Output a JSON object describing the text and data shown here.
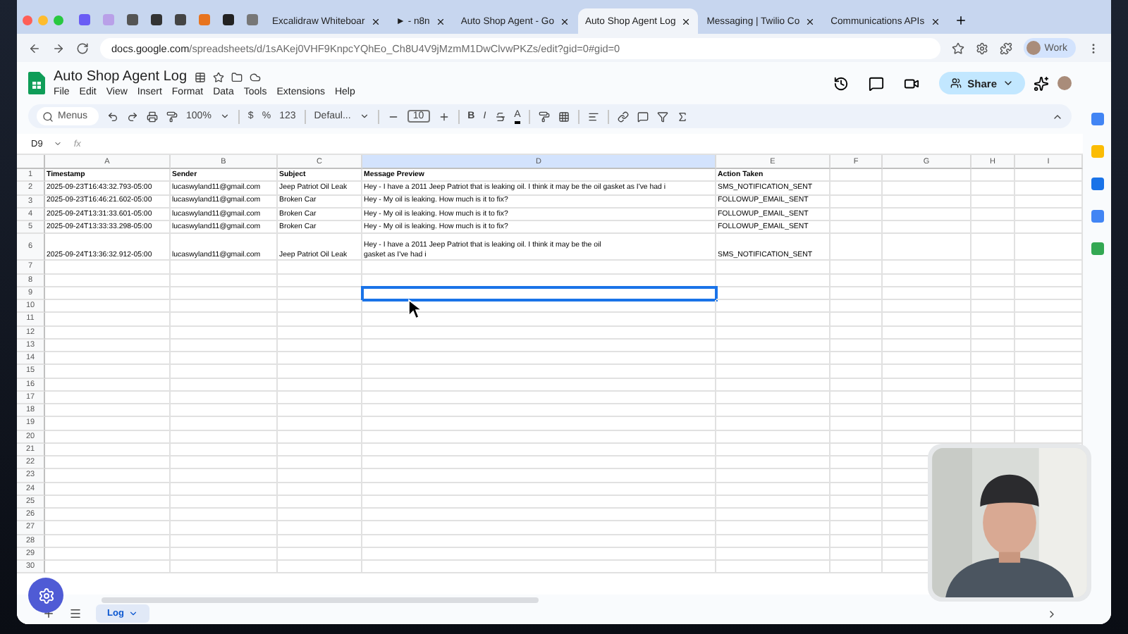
{
  "browser": {
    "tabs": [
      {
        "label": "Excalidraw Whiteboar",
        "selected": false
      },
      {
        "label": "► - n8n",
        "selected": false
      },
      {
        "label": "Auto Shop Agent - Go",
        "selected": false
      },
      {
        "label": "Auto Shop Agent Log",
        "selected": true
      },
      {
        "label": "Messaging | Twilio Co",
        "selected": false
      },
      {
        "label": "Communications APIs",
        "selected": false
      }
    ],
    "url_host": "docs.google.com",
    "url_path": "/spreadsheets/d/1sAKej0VHF9KnpcYQhEo_Ch8U4V9jMzmM1DwClvwPKZs/edit?gid=0#gid=0",
    "profile": "Work"
  },
  "doc": {
    "title": "Auto Shop Agent Log",
    "menus": [
      "File",
      "Edit",
      "View",
      "Insert",
      "Format",
      "Data",
      "Tools",
      "Extensions",
      "Help"
    ],
    "share": "Share"
  },
  "toolbar": {
    "search_placeholder": "Menus",
    "zoom": "100%",
    "currency": "$",
    "percent": "%",
    "number_format": "123",
    "font": "Defaul...",
    "font_size": "10",
    "bold": "B",
    "italic": "I",
    "text_color": "A"
  },
  "formula_bar": {
    "name_box": "D9",
    "fx": "fx"
  },
  "sheet": {
    "columns": [
      {
        "letter": "A",
        "selected": false
      },
      {
        "letter": "B",
        "selected": false
      },
      {
        "letter": "C",
        "selected": false
      },
      {
        "letter": "D",
        "selected": true
      },
      {
        "letter": "E",
        "selected": false
      },
      {
        "letter": "F",
        "selected": false
      },
      {
        "letter": "G",
        "selected": false
      },
      {
        "letter": "H",
        "selected": false
      },
      {
        "letter": "I",
        "selected": false
      }
    ],
    "rows": [
      {
        "number": "1",
        "kind": "header",
        "cells": [
          "Timestamp",
          "Sender",
          "Subject",
          "Message Preview",
          "Action Taken"
        ]
      },
      {
        "number": "2",
        "kind": "data",
        "cells": [
          "2025-09-23T16:43:32.793-05:00",
          "lucaswyland11@gmail.com",
          "Jeep Patriot Oil Leak",
          "Hey - I have a 2011 Jeep Patriot that is leaking oil. I think it may be the oil gasket as I've had i",
          "SMS_NOTIFICATION_SENT"
        ]
      },
      {
        "number": "3",
        "kind": "data",
        "cells": [
          "2025-09-23T16:46:21.602-05:00",
          "lucaswyland11@gmail.com",
          "Broken Car",
          "Hey - My oil is leaking. How much is it to fix?",
          "FOLLOWUP_EMAIL_SENT"
        ]
      },
      {
        "number": "4",
        "kind": "data",
        "cells": [
          "2025-09-24T13:31:33.601-05:00",
          "lucaswyland11@gmail.com",
          "Broken Car",
          "Hey - My oil is leaking. How much is it to fix?",
          "FOLLOWUP_EMAIL_SENT"
        ]
      },
      {
        "number": "5",
        "kind": "data",
        "cells": [
          "2025-09-24T13:33:33.298-05:00",
          "lucaswyland11@gmail.com",
          "Broken Car",
          "Hey - My oil is leaking. How much is it to fix?",
          "FOLLOWUP_EMAIL_SENT"
        ]
      },
      {
        "number": "6",
        "kind": "tall",
        "cells": [
          "2025-09-24T13:36:32.912-05:00",
          "lucaswyland11@gmail.com",
          "Jeep Patriot Oil Leak",
          "Hey - I have a 2011 Jeep Patriot that is leaking oil. I think it may be the oil gasket as I've had i",
          "SMS_NOTIFICATION_SENT"
        ]
      },
      {
        "number": "7"
      },
      {
        "number": "8"
      },
      {
        "number": "9",
        "selected_cells": [
          false,
          false,
          false,
          true,
          false,
          false,
          false,
          false,
          false
        ]
      },
      {
        "number": "10"
      },
      {
        "number": "11"
      },
      {
        "number": "12"
      },
      {
        "number": "13"
      },
      {
        "number": "14"
      },
      {
        "number": "15"
      },
      {
        "number": "16"
      },
      {
        "number": "17"
      },
      {
        "number": "18"
      },
      {
        "number": "19"
      },
      {
        "number": "20"
      },
      {
        "number": "21"
      },
      {
        "number": "22"
      },
      {
        "number": "23"
      },
      {
        "number": "24"
      },
      {
        "number": "25"
      },
      {
        "number": "26"
      },
      {
        "number": "27"
      },
      {
        "number": "28"
      },
      {
        "number": "29"
      },
      {
        "number": "30"
      }
    ]
  },
  "sheet_tabs": [
    {
      "label": "Log",
      "selected": true
    }
  ]
}
